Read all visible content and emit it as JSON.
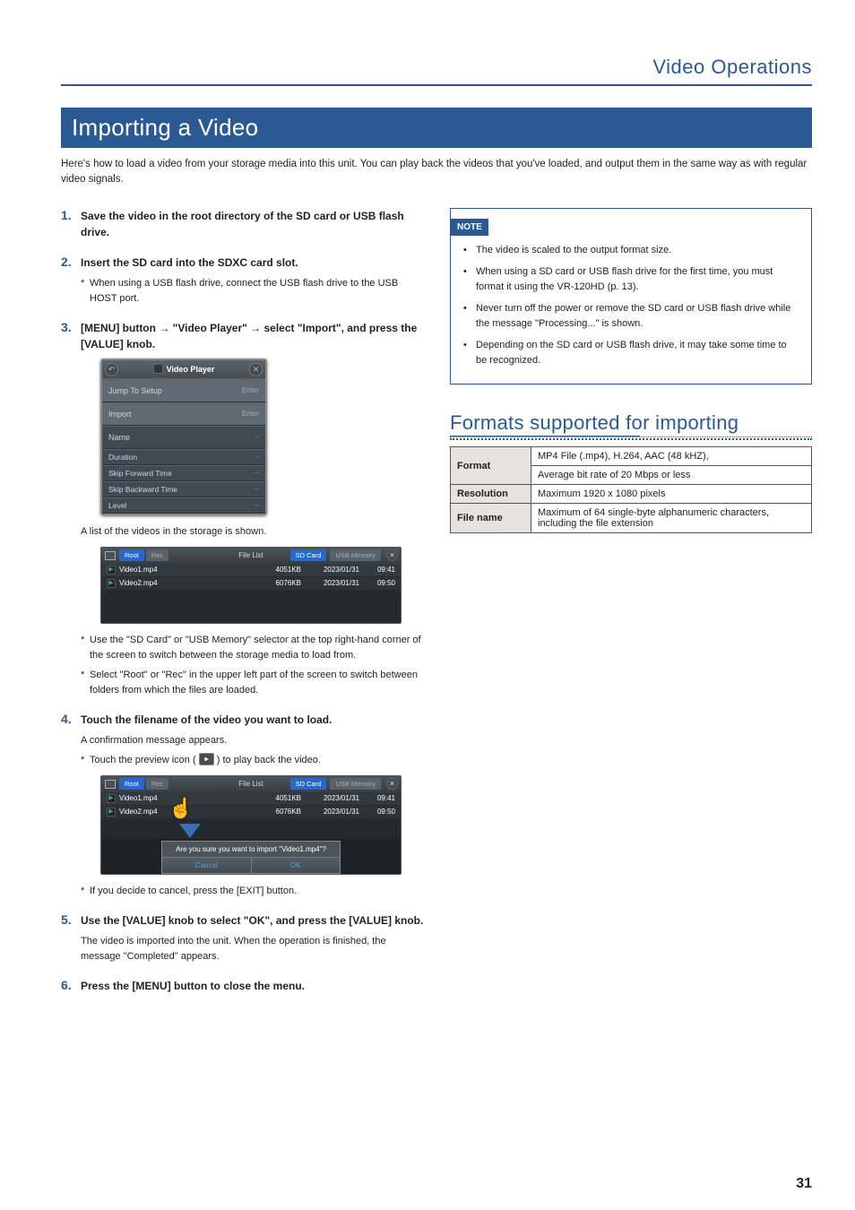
{
  "sectionHeader": "Video Operations",
  "title": "Importing a Video",
  "intro": "Here's how to load a video from your storage media into this unit. You can play back the videos that you've loaded, and output them in the same way as with regular video signals.",
  "steps": {
    "s1": {
      "num": "1.",
      "text": "Save the video in the root directory of the SD card or USB flash drive."
    },
    "s2": {
      "num": "2.",
      "text": "Insert the SD card into the SDXC card slot.",
      "sub": "When using a USB flash drive, connect the USB flash drive to the USB HOST port."
    },
    "s3": {
      "num": "3.",
      "text": "[MENU] button → \"Video Player\" → select \"Import\", and press the [VALUE] knob.",
      "after": "A list of the videos in the storage is shown.",
      "sub1": "Use the \"SD Card\" or \"USB Memory\" selector at the top right-hand corner of the screen to switch between the storage media to load from.",
      "sub2": "Select \"Root\" or \"Rec\" in the upper left part of the screen to switch between folders from which the files are loaded."
    },
    "s4": {
      "num": "4.",
      "text": "Touch the filename of the video you want to load.",
      "after": "A confirmation message appears.",
      "sub_a": "Touch the preview icon (",
      "sub_b": ") to play back the video.",
      "sub2": "If you decide to cancel, press the [EXIT] button."
    },
    "s5": {
      "num": "5.",
      "text": "Use the [VALUE] knob to select \"OK\", and press the [VALUE] knob.",
      "after": "The video is imported into the unit. When the operation is finished, the message \"Completed\" appears."
    },
    "s6": {
      "num": "6.",
      "text": "Press the [MENU] button to close the menu."
    }
  },
  "vp": {
    "title": "Video Player",
    "rows": {
      "jump": {
        "label": "Jump To Setup",
        "val": "Enter"
      },
      "import": {
        "label": "Import",
        "val": "Enter"
      },
      "name": {
        "label": "Name",
        "val": "–"
      },
      "duration": {
        "label": "Duration",
        "val": "–"
      },
      "sft": {
        "label": "Skip Forward Time",
        "val": "–"
      },
      "sbt": {
        "label": "Skip Backward Time",
        "val": "–"
      },
      "level": {
        "label": "Level",
        "val": "–"
      }
    }
  },
  "fl": {
    "tab_root": "Root",
    "tab_rec": "Rec",
    "title": "File List",
    "src_sd": "SD Card",
    "src_usb": "USB Memory",
    "rows": [
      {
        "name": "Video1.mp4",
        "size": "4051KB",
        "date": "2023/01/31",
        "time": "09:41"
      },
      {
        "name": "Video2.mp4",
        "size": "6076KB",
        "date": "2023/01/31",
        "time": "09:50"
      }
    ]
  },
  "dialog": {
    "msg": "Are you sure you want to import \"Video1.mp4\"?",
    "cancel": "Cancel",
    "ok": "OK"
  },
  "note": {
    "label": "NOTE",
    "items": [
      "The video is scaled to the output format size.",
      "When using a SD card or USB flash drive for the first time, you must format it using the VR-120HD (p. 13).",
      "Never turn off the power or remove the SD card or USB flash drive while the message \"Processing...\" is shown.",
      "Depending on the SD card or USB flash drive, it may take some time to be recognized."
    ]
  },
  "formats": {
    "heading": "Formats supported for importing",
    "rows": {
      "format": {
        "h": "Format",
        "v1": "MP4 File (.mp4), H.264, AAC (48 kHZ),",
        "v2": "Average bit rate of 20 Mbps or less"
      },
      "resolution": {
        "h": "Resolution",
        "v": "Maximum 1920 x 1080 pixels"
      },
      "filename": {
        "h": "File name",
        "v": "Maximum of 64 single-byte alphanumeric characters, including the file extension"
      }
    }
  },
  "pageNum": "31"
}
